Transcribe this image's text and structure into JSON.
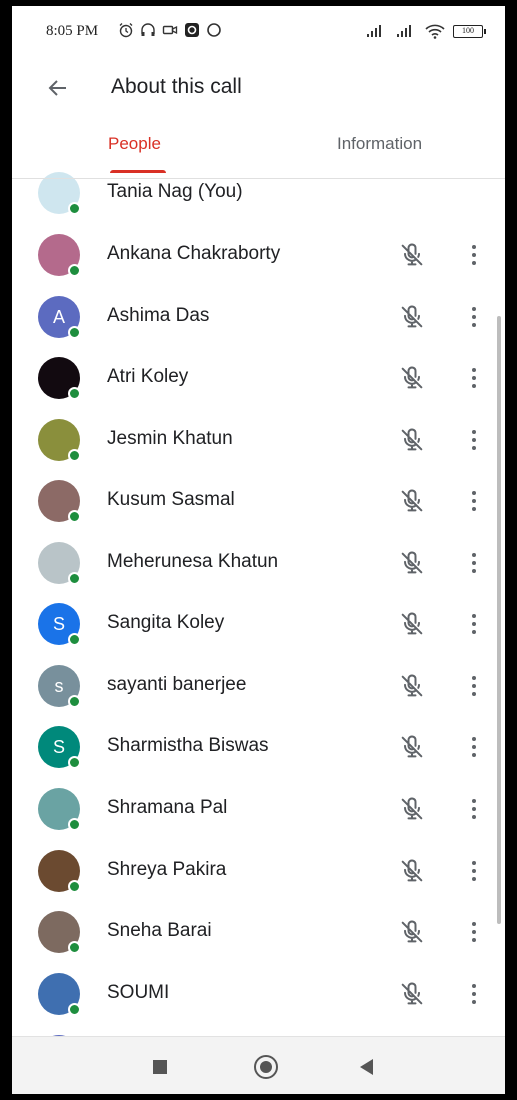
{
  "status_bar": {
    "time": "8:05 PM",
    "battery": "100"
  },
  "header": {
    "title": "About this call"
  },
  "tabs": [
    {
      "label": "People",
      "active": true
    },
    {
      "label": "Information",
      "active": false
    }
  ],
  "colors": {
    "accent": "#d93025",
    "online": "#1e8e3e"
  },
  "participants": [
    {
      "name": "Tania Nag (You)",
      "avatar": "photo",
      "avatar_color": "#cfe6ef",
      "muted_icon": false
    },
    {
      "name": "Ankana Chakraborty",
      "avatar": "photo",
      "avatar_color": "#b46a8c",
      "muted_icon": true
    },
    {
      "name": "Ashima Das",
      "avatar": "letter",
      "letter": "A",
      "avatar_color": "#5c6bc0",
      "muted_icon": true
    },
    {
      "name": "Atri Koley",
      "avatar": "photo",
      "avatar_color": "#120a10",
      "muted_icon": true
    },
    {
      "name": "Jesmin Khatun",
      "avatar": "photo",
      "avatar_color": "#8a8f3c",
      "muted_icon": true
    },
    {
      "name": "Kusum Sasmal",
      "avatar": "photo",
      "avatar_color": "#8c6a66",
      "muted_icon": true
    },
    {
      "name": "Meherunesa Khatun",
      "avatar": "photo",
      "avatar_color": "#b9c4c8",
      "muted_icon": true
    },
    {
      "name": "Sangita Koley",
      "avatar": "letter",
      "letter": "S",
      "avatar_color": "#1a73e8",
      "muted_icon": true
    },
    {
      "name": "sayanti banerjee",
      "avatar": "letter",
      "letter": "s",
      "avatar_color": "#78909c",
      "muted_icon": true
    },
    {
      "name": "Sharmistha Biswas",
      "avatar": "letter",
      "letter": "S",
      "avatar_color": "#00897b",
      "muted_icon": true
    },
    {
      "name": "Shramana Pal",
      "avatar": "photo",
      "avatar_color": "#6aa3a3",
      "muted_icon": true
    },
    {
      "name": "Shreya Pakira",
      "avatar": "photo",
      "avatar_color": "#6b4a30",
      "muted_icon": true
    },
    {
      "name": "Sneha Barai",
      "avatar": "photo",
      "avatar_color": "#7d6a60",
      "muted_icon": true
    },
    {
      "name": "SOUMI",
      "avatar": "photo",
      "avatar_color": "#3f6fb0",
      "muted_icon": true
    },
    {
      "name": "",
      "avatar": "letter",
      "letter": "",
      "avatar_color": "#5c6bc0",
      "muted_icon": false
    }
  ]
}
